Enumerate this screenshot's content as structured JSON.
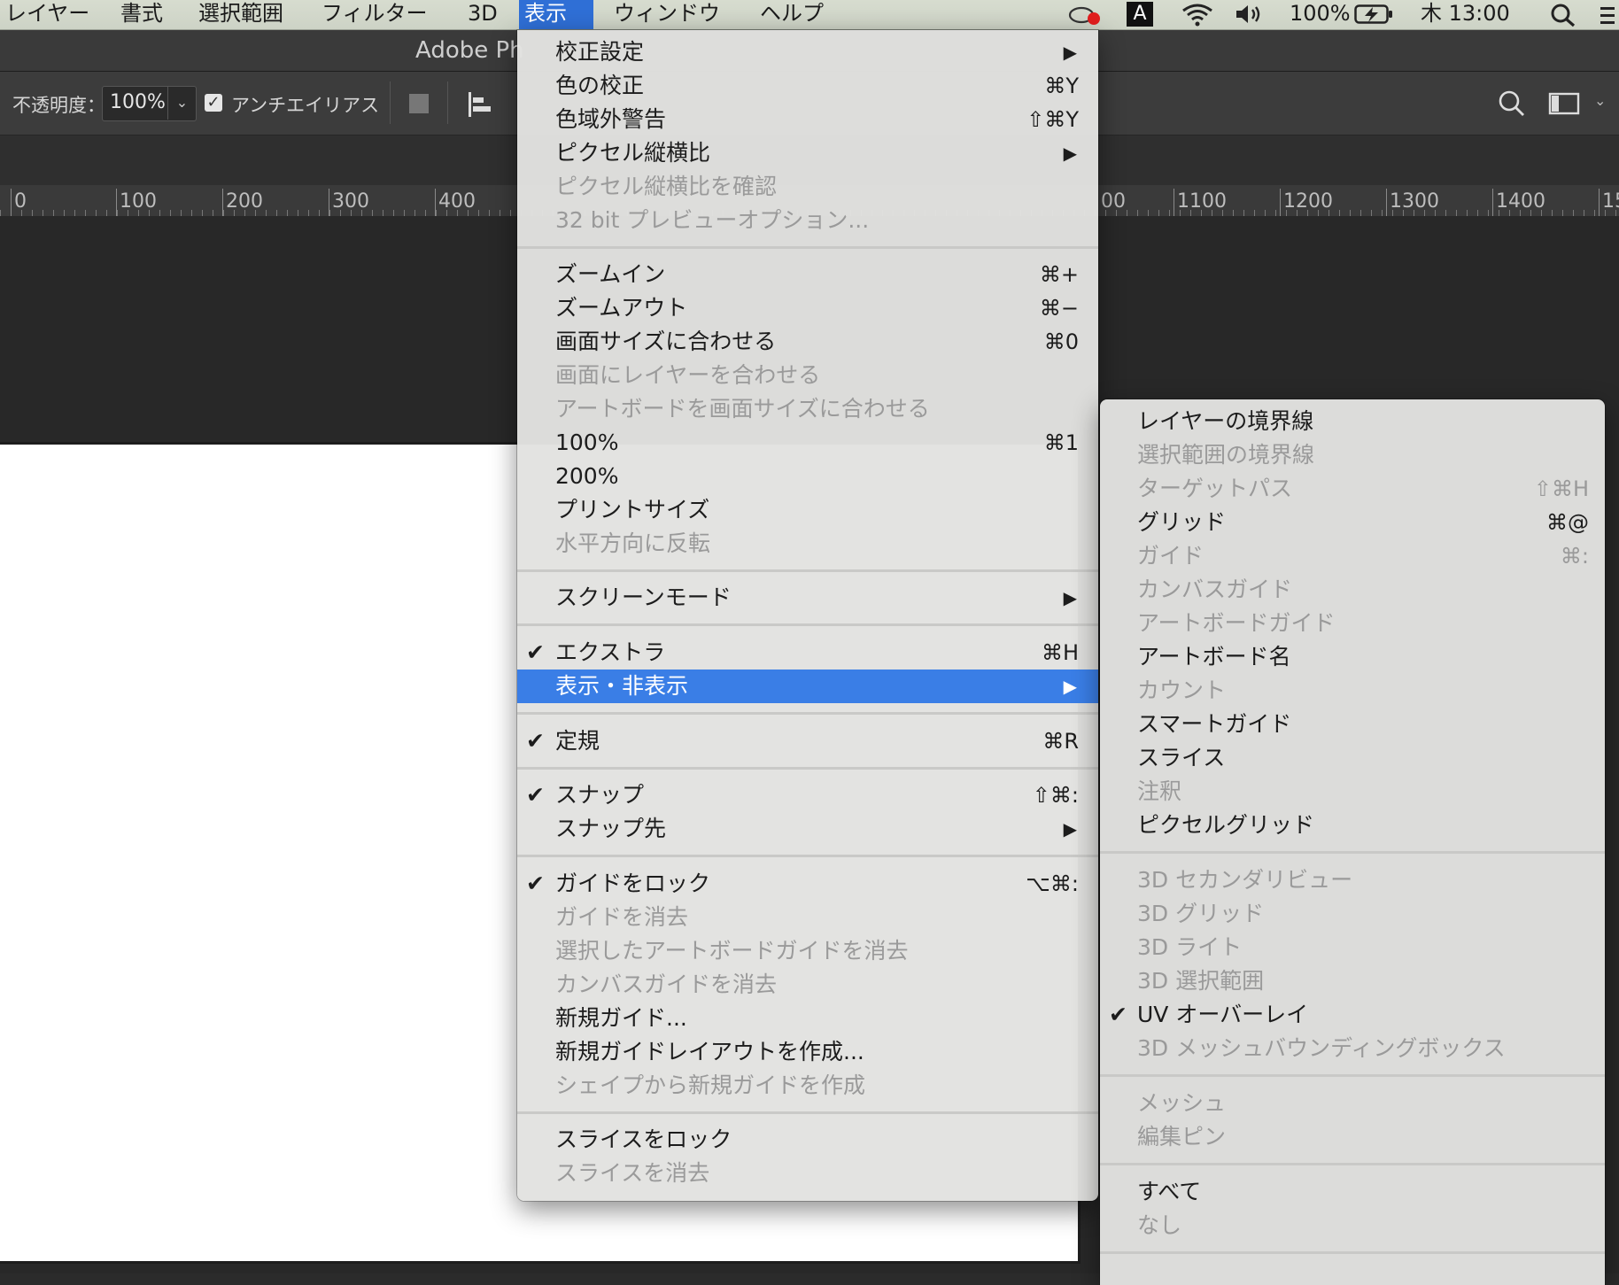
{
  "menubar": {
    "items": [
      "レイヤー",
      "書式",
      "選択範囲",
      "フィルター",
      "3D",
      "表示",
      "ウィンドウ",
      "ヘルプ"
    ],
    "active_index": 5,
    "input_method": "A",
    "battery": "100%",
    "clock": "木 13:00"
  },
  "app": {
    "title": "Adobe Ph"
  },
  "options": {
    "opacity_label": "不透明度：",
    "opacity_value": "100%",
    "antialias_label": "アンチエイリアス"
  },
  "ruler": {
    "labels_left": [
      "0",
      "100",
      "200",
      "300",
      "400"
    ],
    "labels_right": [
      "00",
      "1100",
      "1200",
      "1300",
      "1400",
      "15"
    ]
  },
  "view_menu": {
    "items": [
      {
        "label": "校正設定",
        "shortcut": "",
        "submenu": true,
        "enabled": true,
        "checked": false
      },
      {
        "label": "色の校正",
        "shortcut": "⌘Y",
        "submenu": false,
        "enabled": true,
        "checked": false
      },
      {
        "label": "色域外警告",
        "shortcut": "⇧⌘Y",
        "submenu": false,
        "enabled": true,
        "checked": false
      },
      {
        "label": "ピクセル縦横比",
        "shortcut": "",
        "submenu": true,
        "enabled": true,
        "checked": false
      },
      {
        "label": "ピクセル縦横比を確認",
        "shortcut": "",
        "submenu": false,
        "enabled": false,
        "checked": false
      },
      {
        "label": "32 bit プレビューオプション...",
        "shortcut": "",
        "submenu": false,
        "enabled": false,
        "checked": false
      },
      {
        "label": "ズームイン",
        "shortcut": "⌘+",
        "submenu": false,
        "enabled": true,
        "checked": false
      },
      {
        "label": "ズームアウト",
        "shortcut": "⌘−",
        "submenu": false,
        "enabled": true,
        "checked": false
      },
      {
        "label": "画面サイズに合わせる",
        "shortcut": "⌘0",
        "submenu": false,
        "enabled": true,
        "checked": false
      },
      {
        "label": "画面にレイヤーを合わせる",
        "shortcut": "",
        "submenu": false,
        "enabled": false,
        "checked": false
      },
      {
        "label": "アートボードを画面サイズに合わせる",
        "shortcut": "",
        "submenu": false,
        "enabled": false,
        "checked": false
      },
      {
        "label": "100%",
        "shortcut": "⌘1",
        "submenu": false,
        "enabled": true,
        "checked": false
      },
      {
        "label": "200%",
        "shortcut": "",
        "submenu": false,
        "enabled": true,
        "checked": false
      },
      {
        "label": "プリントサイズ",
        "shortcut": "",
        "submenu": false,
        "enabled": true,
        "checked": false
      },
      {
        "label": "水平方向に反転",
        "shortcut": "",
        "submenu": false,
        "enabled": false,
        "checked": false
      },
      {
        "label": "スクリーンモード",
        "shortcut": "",
        "submenu": true,
        "enabled": true,
        "checked": false
      },
      {
        "label": "エクストラ",
        "shortcut": "⌘H",
        "submenu": false,
        "enabled": true,
        "checked": true
      },
      {
        "label": "表示・非表示",
        "shortcut": "",
        "submenu": true,
        "enabled": true,
        "checked": false,
        "highlighted": true
      },
      {
        "label": "定規",
        "shortcut": "⌘R",
        "submenu": false,
        "enabled": true,
        "checked": true
      },
      {
        "label": "スナップ",
        "shortcut": "⇧⌘:",
        "submenu": false,
        "enabled": true,
        "checked": true
      },
      {
        "label": "スナップ先",
        "shortcut": "",
        "submenu": true,
        "enabled": true,
        "checked": false
      },
      {
        "label": "ガイドをロック",
        "shortcut": "⌥⌘:",
        "submenu": false,
        "enabled": true,
        "checked": true
      },
      {
        "label": "ガイドを消去",
        "shortcut": "",
        "submenu": false,
        "enabled": false,
        "checked": false
      },
      {
        "label": "選択したアートボードガイドを消去",
        "shortcut": "",
        "submenu": false,
        "enabled": false,
        "checked": false
      },
      {
        "label": "カンバスガイドを消去",
        "shortcut": "",
        "submenu": false,
        "enabled": false,
        "checked": false
      },
      {
        "label": "新規ガイド...",
        "shortcut": "",
        "submenu": false,
        "enabled": true,
        "checked": false
      },
      {
        "label": "新規ガイドレイアウトを作成...",
        "shortcut": "",
        "submenu": false,
        "enabled": true,
        "checked": false
      },
      {
        "label": "シェイプから新規ガイドを作成",
        "shortcut": "",
        "submenu": false,
        "enabled": false,
        "checked": false
      },
      {
        "label": "スライスをロック",
        "shortcut": "",
        "submenu": false,
        "enabled": true,
        "checked": false
      },
      {
        "label": "スライスを消去",
        "shortcut": "",
        "submenu": false,
        "enabled": false,
        "checked": false
      }
    ]
  },
  "show_menu": {
    "items": [
      {
        "label": "レイヤーの境界線",
        "shortcut": "",
        "enabled": true,
        "checked": false
      },
      {
        "label": "選択範囲の境界線",
        "shortcut": "",
        "enabled": false,
        "checked": false
      },
      {
        "label": "ターゲットパス",
        "shortcut": "⇧⌘H",
        "enabled": false,
        "checked": false
      },
      {
        "label": "グリッド",
        "shortcut": "⌘@",
        "enabled": true,
        "checked": false
      },
      {
        "label": "ガイド",
        "shortcut": "⌘:",
        "enabled": false,
        "checked": false
      },
      {
        "label": "カンバスガイド",
        "shortcut": "",
        "enabled": false,
        "checked": false
      },
      {
        "label": "アートボードガイド",
        "shortcut": "",
        "enabled": false,
        "checked": false
      },
      {
        "label": "アートボード名",
        "shortcut": "",
        "enabled": true,
        "checked": false
      },
      {
        "label": "カウント",
        "shortcut": "",
        "enabled": false,
        "checked": false
      },
      {
        "label": "スマートガイド",
        "shortcut": "",
        "enabled": true,
        "checked": false
      },
      {
        "label": "スライス",
        "shortcut": "",
        "enabled": true,
        "checked": false
      },
      {
        "label": "注釈",
        "shortcut": "",
        "enabled": false,
        "checked": false
      },
      {
        "label": "ピクセルグリッド",
        "shortcut": "",
        "enabled": true,
        "checked": false
      },
      {
        "label": "3D セカンダリビュー",
        "shortcut": "",
        "enabled": false,
        "checked": false
      },
      {
        "label": "3D グリッド",
        "shortcut": "",
        "enabled": false,
        "checked": false
      },
      {
        "label": "3D ライト",
        "shortcut": "",
        "enabled": false,
        "checked": false
      },
      {
        "label": "3D 選択範囲",
        "shortcut": "",
        "enabled": false,
        "checked": false
      },
      {
        "label": "UV オーバーレイ",
        "shortcut": "",
        "enabled": true,
        "checked": true
      },
      {
        "label": "3D メッシュバウンディングボックス",
        "shortcut": "",
        "enabled": false,
        "checked": false
      },
      {
        "label": "メッシュ",
        "shortcut": "",
        "enabled": false,
        "checked": false
      },
      {
        "label": "編集ピン",
        "shortcut": "",
        "enabled": false,
        "checked": false
      },
      {
        "label": "すべて",
        "shortcut": "",
        "enabled": true,
        "checked": false
      },
      {
        "label": "なし",
        "shortcut": "",
        "enabled": false,
        "checked": false
      }
    ]
  },
  "icons": {
    "check": "✔",
    "submenu_arrow": "▶",
    "chevron": "⌄"
  }
}
